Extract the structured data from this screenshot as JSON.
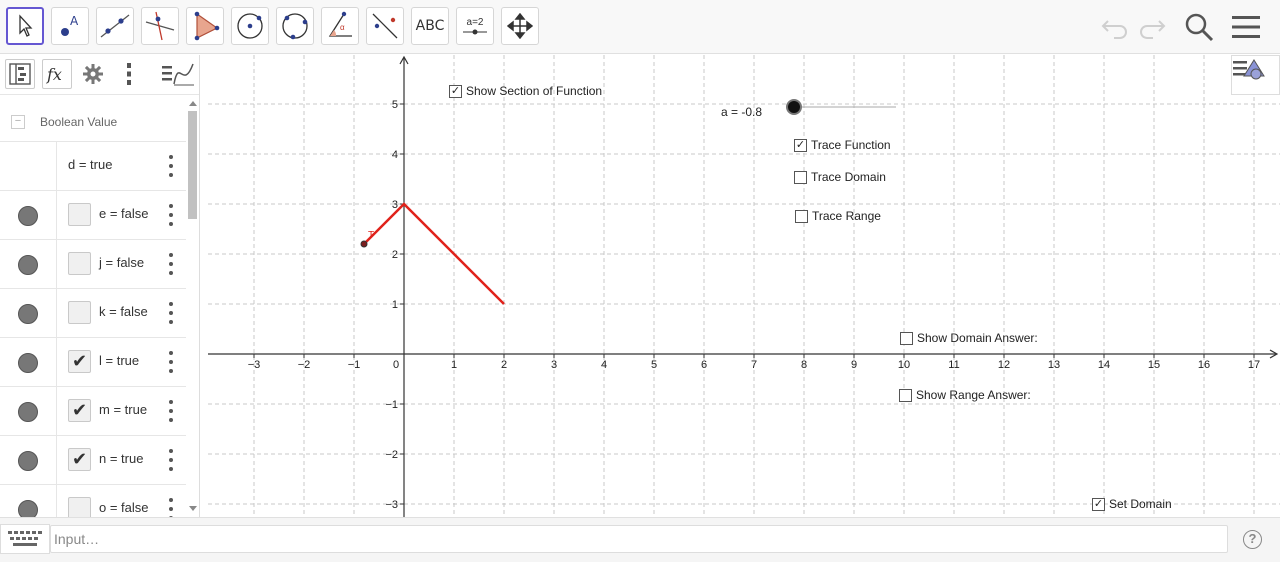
{
  "toolbar": {
    "tools": [
      {
        "name": "move-tool-button",
        "icon": "pointer-arrow-icon"
      },
      {
        "name": "point-tool-button",
        "icon": "point-icon"
      },
      {
        "name": "line-tool-button",
        "icon": "line-through-points-icon"
      },
      {
        "name": "perpendicular-line-tool-button",
        "icon": "perpendicular-line-icon"
      },
      {
        "name": "polygon-tool-button",
        "icon": "polygon-icon"
      },
      {
        "name": "circle-center-point-tool-button",
        "icon": "circle-icon"
      },
      {
        "name": "circle-three-points-tool-button",
        "icon": "circle-three-points-icon"
      },
      {
        "name": "angle-tool-button",
        "icon": "angle-icon"
      },
      {
        "name": "reflect-tool-button",
        "icon": "reflect-about-line-icon"
      },
      {
        "name": "text-tool-button",
        "label": "ABC"
      },
      {
        "name": "slider-tool-button",
        "label": "a=2"
      },
      {
        "name": "move-graphics-view-button",
        "icon": "move-arrows-icon"
      }
    ],
    "right_icons": [
      "undo-icon",
      "redo-icon",
      "search-icon",
      "hamburger-menu-icon"
    ]
  },
  "algebra": {
    "header_icons": [
      "algebra-view-icon",
      "fx-icon",
      "gear-icon",
      "vertical-dots-icon",
      "graph-style-icon"
    ],
    "group_label": "Boolean Value",
    "first_row": "d = true",
    "rows": [
      {
        "label": "e = false",
        "checked": false
      },
      {
        "label": "j = false",
        "checked": false
      },
      {
        "label": "k = false",
        "checked": false
      },
      {
        "label": "l = true",
        "checked": true
      },
      {
        "label": "m = true",
        "checked": true
      },
      {
        "label": "n = true",
        "checked": true
      },
      {
        "label": "o = false",
        "checked": false
      }
    ]
  },
  "graphics": {
    "checkboxes": {
      "show_section": {
        "label": "Show Section of Function",
        "checked": true
      },
      "trace_function": {
        "label": "Trace Function",
        "checked": true
      },
      "trace_domain": {
        "label": "Trace Domain",
        "checked": false
      },
      "trace_range": {
        "label": "Trace Range",
        "checked": false
      },
      "show_domain_answer": {
        "label": "Show Domain Answer:",
        "checked": false
      },
      "show_range_answer": {
        "label": "Show Range Answer:",
        "checked": false
      },
      "set_domain": {
        "label": "Set Domain",
        "checked": true
      }
    },
    "slider": {
      "label": "a = -0.8",
      "value": -0.8
    },
    "x_ticks": [
      "−3",
      "−2",
      "−1",
      "0",
      "1",
      "2",
      "3",
      "4",
      "5",
      "6",
      "7",
      "8",
      "9",
      "10",
      "11",
      "12",
      "13",
      "14",
      "15",
      "16",
      "17"
    ],
    "y_ticks": [
      "5",
      "4",
      "3",
      "2",
      "1",
      "−1",
      "−2",
      "−3"
    ],
    "function_points": [
      [
        -0.8,
        2.2
      ],
      [
        0,
        3
      ],
      [
        2,
        1
      ]
    ],
    "point_label": "T",
    "line_color": "#e0221b"
  },
  "input": {
    "placeholder": "Input…",
    "help": "?"
  }
}
